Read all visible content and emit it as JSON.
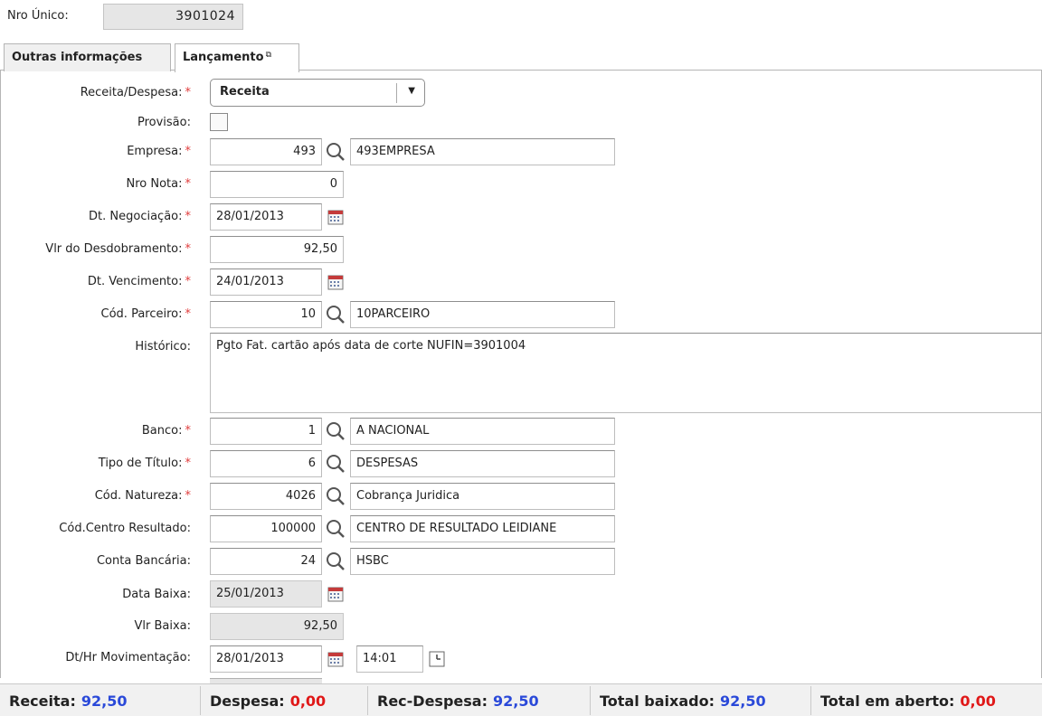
{
  "header": {
    "nro_unico_label": "Nro Único:",
    "nro_unico_value": "3901024"
  },
  "tabs": [
    {
      "label": "Outras informações"
    },
    {
      "label": "Lançamento",
      "popout_glyph": "⧉"
    }
  ],
  "form": {
    "receita_despesa": {
      "label": "Receita/Despesa:",
      "value": "Receita",
      "required": "*"
    },
    "provisao": {
      "label": "Provisão:",
      "checked": false
    },
    "empresa": {
      "label": "Empresa:",
      "code": "493",
      "desc": "493EMPRESA",
      "required": "*"
    },
    "nro_nota": {
      "label": "Nro Nota:",
      "value": "0",
      "required": "*"
    },
    "dt_negociacao": {
      "label": "Dt. Negociação:",
      "value": "28/01/2013",
      "required": "*"
    },
    "vlr_desdobramento": {
      "label": "Vlr do Desdobramento:",
      "value": "92,50",
      "required": "*"
    },
    "dt_vencimento": {
      "label": "Dt. Vencimento:",
      "value": "24/01/2013",
      "required": "*"
    },
    "cod_parceiro": {
      "label": "Cód. Parceiro:",
      "code": "10",
      "desc": "10PARCEIRO",
      "required": "*"
    },
    "historico": {
      "label": "Histórico:",
      "value": "Pgto Fat. cartão após data de corte NUFIN=3901004"
    },
    "banco": {
      "label": "Banco:",
      "code": "1",
      "desc": "A NACIONAL",
      "required": "*"
    },
    "tipo_titulo": {
      "label": "Tipo de Título:",
      "code": "6",
      "desc": "DESPESAS",
      "required": "*"
    },
    "cod_natureza": {
      "label": "Cód. Natureza:",
      "code": "4026",
      "desc": "Cobrança Juridica",
      "required": "*"
    },
    "cod_centro_resultado": {
      "label": "Cód.Centro Resultado:",
      "code": "100000",
      "desc": "CENTRO DE RESULTADO LEIDIANE"
    },
    "conta_bancaria": {
      "label": "Conta Bancária:",
      "code": "24",
      "desc": "HSBC"
    },
    "data_baixa": {
      "label": "Data Baixa:",
      "value": "25/01/2013"
    },
    "vlr_baixa": {
      "label": "Vlr Baixa:",
      "value": "92,50"
    },
    "dt_hr_movimentacao": {
      "label": "Dt/Hr Movimentação:",
      "date": "28/01/2013",
      "time": "14:01"
    }
  },
  "status_bar": {
    "receita": {
      "label": "Receita:",
      "value": "92,50"
    },
    "despesa": {
      "label": "Despesa:",
      "value": "0,00"
    },
    "rec_despesa": {
      "label": "Rec-Despesa:",
      "value": "92,50"
    },
    "total_baixado": {
      "label": "Total baixado:",
      "value": "92,50"
    },
    "total_em_aberto": {
      "label": "Total em aberto:",
      "value": "0,00"
    }
  },
  "icons": {
    "lookup": "magnifier-icon",
    "calendar": "calendar-icon",
    "clock": "clock-icon",
    "dropdown": "chevron-down-icon"
  },
  "colors": {
    "required": "#e03c3c",
    "positive_value": "#2a49d9",
    "negative_value": "#e01818"
  }
}
